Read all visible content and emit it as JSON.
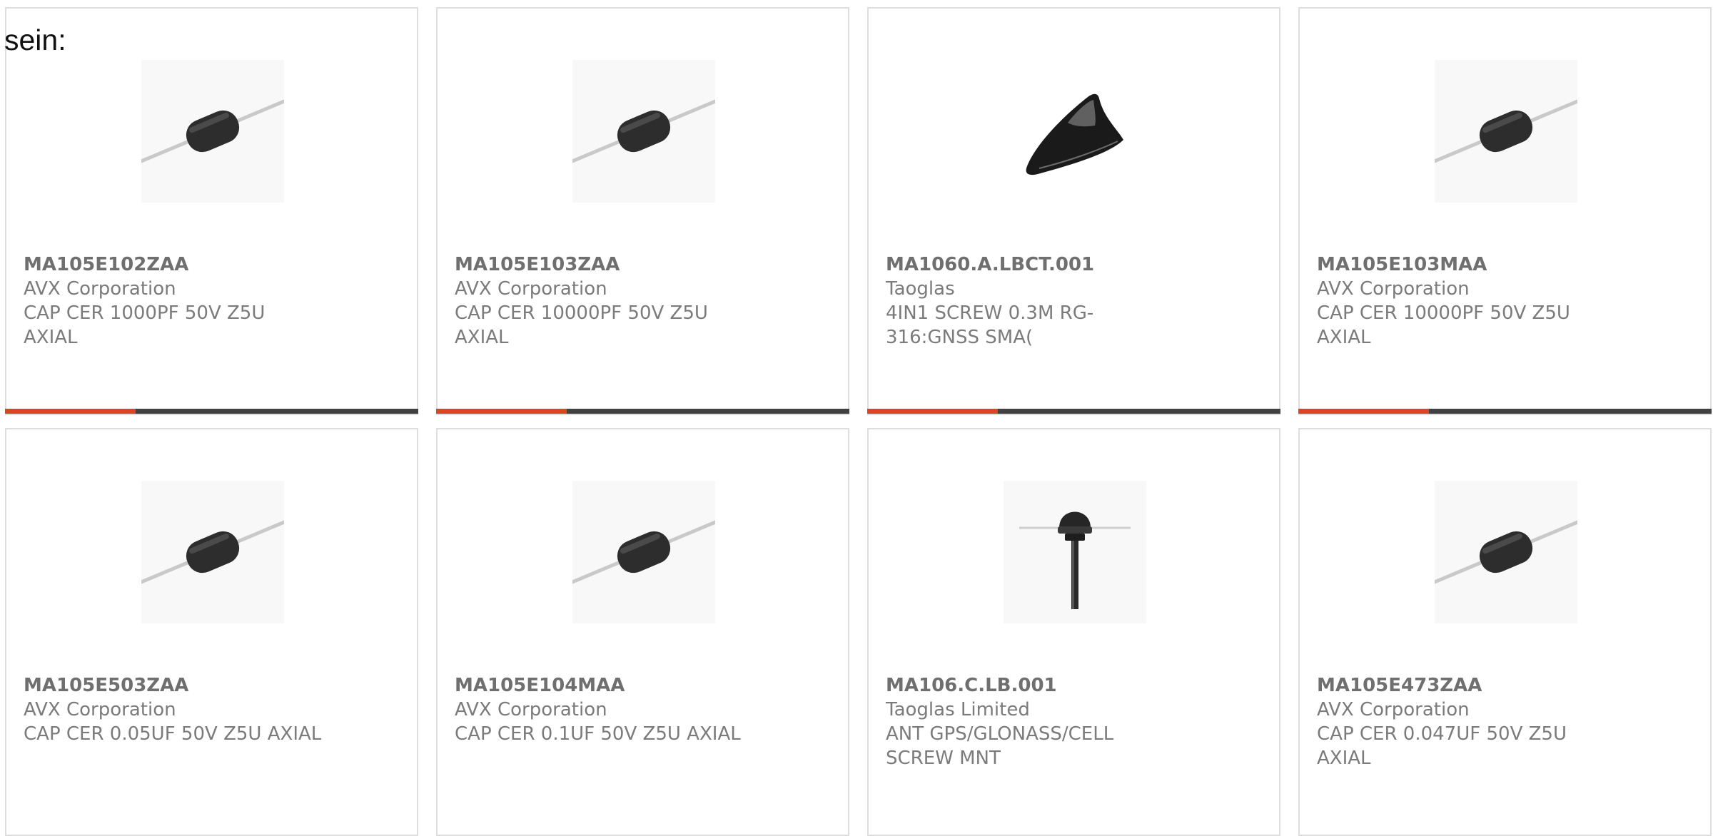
{
  "header_label": "sein:",
  "colors": {
    "accent": "#d9461f",
    "bar": "#414141",
    "border": "#dedede",
    "text": "#7b7b7b"
  },
  "products": [
    {
      "part_number": "MA105E102ZAA",
      "manufacturer": "AVX Corporation",
      "description": "CAP CER 1000PF 50V Z5U AXIAL",
      "image": "axial-capacitor"
    },
    {
      "part_number": "MA105E103ZAA",
      "manufacturer": "AVX Corporation",
      "description": "CAP CER 10000PF 50V Z5U AXIAL",
      "image": "axial-capacitor"
    },
    {
      "part_number": "MA1060.A.LBCT.001",
      "manufacturer": "Taoglas",
      "description": "4IN1 SCREW 0.3M RG-316:GNSS SMA(",
      "image": "shark-fin-antenna"
    },
    {
      "part_number": "MA105E103MAA",
      "manufacturer": "AVX Corporation",
      "description": "CAP CER 10000PF 50V Z5U AXIAL",
      "image": "axial-capacitor"
    },
    {
      "part_number": "MA105E503ZAA",
      "manufacturer": "AVX Corporation",
      "description": "CAP CER 0.05UF 50V Z5U AXIAL",
      "image": "axial-capacitor"
    },
    {
      "part_number": "MA105E104MAA",
      "manufacturer": "AVX Corporation",
      "description": "CAP CER 0.1UF 50V Z5U AXIAL",
      "image": "axial-capacitor"
    },
    {
      "part_number": "MA106.C.LB.001",
      "manufacturer": "Taoglas Limited",
      "description": "ANT GPS/GLONASS/CELL SCREW MNT",
      "image": "puck-antenna"
    },
    {
      "part_number": "MA105E473ZAA",
      "manufacturer": "AVX Corporation",
      "description": "CAP CER 0.047UF 50V Z5U AXIAL",
      "image": "axial-capacitor"
    }
  ]
}
